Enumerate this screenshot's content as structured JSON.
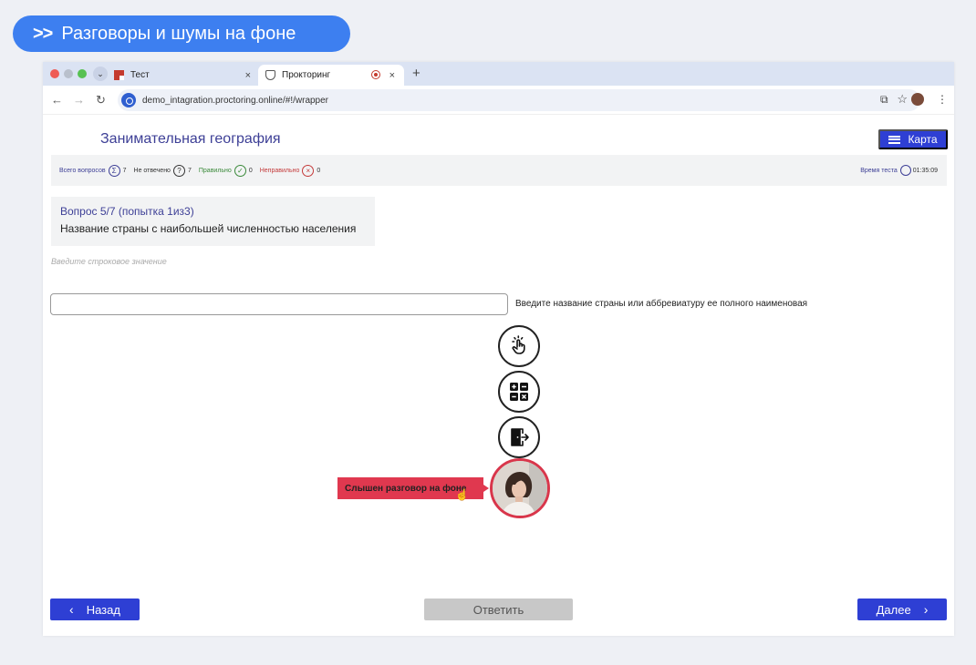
{
  "headline": {
    "arrows": ">>",
    "text": "Разговоры и шумы на фоне"
  },
  "browser": {
    "tabs": [
      {
        "title": "Тест",
        "close": "×"
      },
      {
        "title": "Прокторинг",
        "close": "×"
      }
    ],
    "new_tab": "+",
    "url": "demo_intagration.proctoring.online/#!/wrapper"
  },
  "app": {
    "title": "Занимательная география",
    "map_button": "Карта"
  },
  "stats": {
    "total_label": "Всего вопросов",
    "total_symbol": "Σ",
    "total_value": "7",
    "unanswered_label": "Не отвечено",
    "unanswered_symbol": "?",
    "unanswered_value": "7",
    "correct_label": "Правильно",
    "correct_symbol": "✓",
    "correct_value": "0",
    "wrong_label": "Неправильно",
    "wrong_symbol": "×",
    "wrong_value": "0",
    "time_label": "Время теста",
    "time_value": "01:35:09"
  },
  "question": {
    "header": "Вопрос 5/7  (попытка 1из3)",
    "text": "Название страны с наибольшей численностью населения",
    "hint": "Введите строковое значение",
    "input_value": "",
    "input_note": "Введите название страны или аббревиатуру ее полного наименовая"
  },
  "proctoring": {
    "alert": "Слышен разговор на фоне"
  },
  "footer": {
    "back": "Назад",
    "answer": "Ответить",
    "next": "Далее"
  },
  "colors": {
    "accent": "#2e3fd4",
    "headline": "#3d7ff0",
    "alert": "#e0384f",
    "title": "#3d3f96"
  }
}
